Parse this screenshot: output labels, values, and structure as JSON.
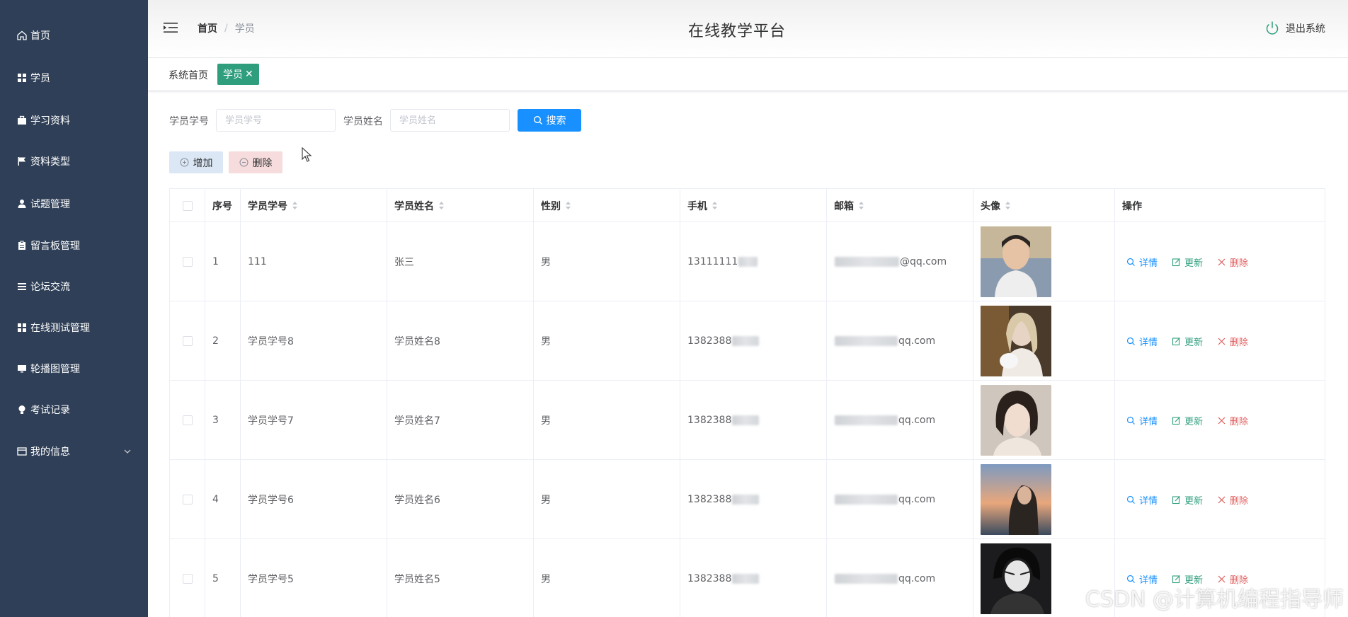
{
  "sidebar": {
    "items": [
      {
        "label": "首页",
        "icon": "home-icon"
      },
      {
        "label": "学员",
        "icon": "grid-icon"
      },
      {
        "label": "学习资料",
        "icon": "briefcase-icon"
      },
      {
        "label": "资料类型",
        "icon": "flag-icon"
      },
      {
        "label": "试题管理",
        "icon": "user-icon"
      },
      {
        "label": "留言板管理",
        "icon": "clipboard-icon"
      },
      {
        "label": "论坛交流",
        "icon": "list-icon"
      },
      {
        "label": "在线测试管理",
        "icon": "grid-icon"
      },
      {
        "label": "轮播图管理",
        "icon": "monitor-icon"
      },
      {
        "label": "考试记录",
        "icon": "bulb-icon"
      },
      {
        "label": "我的信息",
        "icon": "card-icon"
      }
    ]
  },
  "header": {
    "breadcrumb_home": "首页",
    "breadcrumb_sep": "/",
    "breadcrumb_current": "学员",
    "title": "在线教学平台",
    "logout": "退出系统"
  },
  "tags": {
    "home": "系统首页",
    "active": "学员",
    "close": "✕"
  },
  "search": {
    "student_no_label": "学员学号",
    "student_no_placeholder": "学员学号",
    "student_name_label": "学员姓名",
    "student_name_placeholder": "学员姓名",
    "search_button": "搜索"
  },
  "toolbar": {
    "add": "增加",
    "delete": "删除"
  },
  "table": {
    "columns": [
      "序号",
      "学员学号",
      "学员姓名",
      "性别",
      "手机",
      "邮箱",
      "头像",
      "操作"
    ],
    "actions": {
      "detail": "详情",
      "update": "更新",
      "delete": "删除"
    },
    "rows": [
      {
        "index": "1",
        "student_no": "111",
        "name": "张三",
        "gender": "男",
        "phone": "13111111",
        "email": "@qq.com"
      },
      {
        "index": "2",
        "student_no": "学员学号8",
        "name": "学员姓名8",
        "gender": "男",
        "phone": "1382388",
        "email": "qq.com"
      },
      {
        "index": "3",
        "student_no": "学员学号7",
        "name": "学员姓名7",
        "gender": "男",
        "phone": "1382388",
        "email": "qq.com"
      },
      {
        "index": "4",
        "student_no": "学员学号6",
        "name": "学员姓名6",
        "gender": "男",
        "phone": "1382388",
        "email": "qq.com"
      },
      {
        "index": "5",
        "student_no": "学员学号5",
        "name": "学员姓名5",
        "gender": "男",
        "phone": "1382388",
        "email": "qq.com"
      }
    ]
  },
  "watermark": "CSDN @计算机编程指导师",
  "colors": {
    "sidebar_bg": "#2f3f57",
    "primary": "#1890ff",
    "tag_green": "#2e9e7c",
    "danger": "#e05c5c"
  }
}
